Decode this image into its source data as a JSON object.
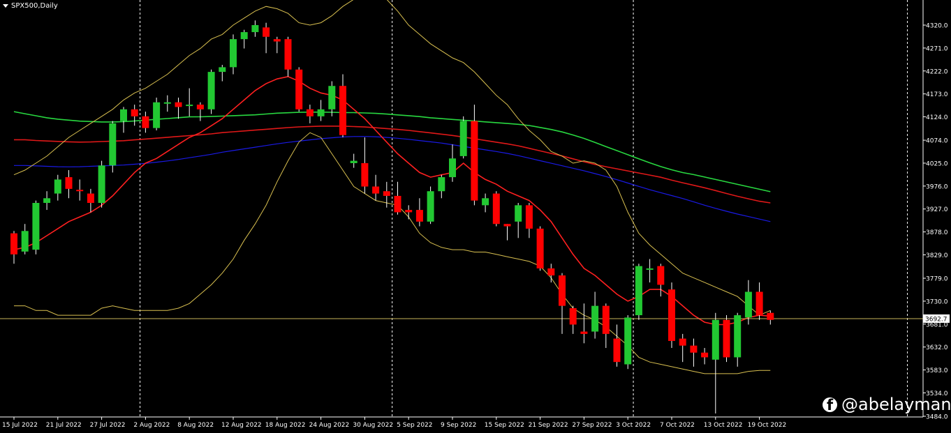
{
  "symbol_label": "SPX500,Daily",
  "watermark": {
    "icon": "facebook-icon",
    "handle": "@abelayman"
  },
  "colors": {
    "background": "#000000",
    "axis": "#ffffff",
    "text": "#ffffff",
    "bull": "#22c832",
    "bear": "#ff0000",
    "wick": "#ffffff",
    "bollinger": "#d9c050",
    "ema_fast": "#ff2020",
    "ma_green": "#28d840",
    "ma_red": "#e01818",
    "ma_blue": "#1a1ae6",
    "price_line": "#c8b45a"
  },
  "chart_data": {
    "type": "candlestick",
    "title": "SPX500,Daily",
    "ylim": [
      3484.0,
      4340.0
    ],
    "y_ticks": [
      "4320.0",
      "4271.0",
      "4222.0",
      "4173.0",
      "4124.0",
      "4074.0",
      "4025.0",
      "3976.0",
      "3927.0",
      "3878.0",
      "3829.0",
      "3779.0",
      "3730.0",
      "3681.0",
      "3632.0",
      "3583.0",
      "3534.0",
      "3484.0"
    ],
    "x_ticks": [
      {
        "i": 0,
        "label": "15 Jul 2022"
      },
      {
        "i": 4,
        "label": "21 Jul 2022"
      },
      {
        "i": 8,
        "label": "27 Jul 2022"
      },
      {
        "i": 12,
        "label": "2 Aug 2022"
      },
      {
        "i": 16,
        "label": "8 Aug 2022"
      },
      {
        "i": 20,
        "label": "12 Aug 2022"
      },
      {
        "i": 24,
        "label": "18 Aug 2022"
      },
      {
        "i": 28,
        "label": "24 Aug 2022"
      },
      {
        "i": 32,
        "label": "30 Aug 2022"
      },
      {
        "i": 36,
        "label": "5 Sep 2022"
      },
      {
        "i": 40,
        "label": "9 Sep 2022"
      },
      {
        "i": 44,
        "label": "15 Sep 2022"
      },
      {
        "i": 48,
        "label": "21 Sep 2022"
      },
      {
        "i": 52,
        "label": "27 Sep 2022"
      },
      {
        "i": 56,
        "label": "3 Oct 2022"
      },
      {
        "i": 60,
        "label": "7 Oct 2022"
      },
      {
        "i": 64,
        "label": "13 Oct 2022"
      },
      {
        "i": 68,
        "label": "19 Oct 2022"
      }
    ],
    "period_separators": [
      11,
      34,
      56,
      81
    ],
    "current_price": "3692.7",
    "candles": [
      [
        3875,
        3830,
        3810,
        3880
      ],
      [
        3836,
        3880,
        3830,
        3895
      ],
      [
        3840,
        3940,
        3830,
        3945
      ],
      [
        3940,
        3950,
        3925,
        3965
      ],
      [
        3960,
        3990,
        3945,
        4000
      ],
      [
        3995,
        3970,
        3950,
        4010
      ],
      [
        3968,
        3965,
        3945,
        3990
      ],
      [
        3960,
        3940,
        3920,
        3970
      ],
      [
        3940,
        4020,
        3930,
        4030
      ],
      [
        4020,
        4110,
        4005,
        4115
      ],
      [
        4115,
        4140,
        4090,
        4145
      ],
      [
        4140,
        4125,
        4105,
        4150
      ],
      [
        4125,
        4100,
        4090,
        4135
      ],
      [
        4100,
        4155,
        4095,
        4165
      ],
      [
        4155,
        4155,
        4135,
        4170
      ],
      [
        4155,
        4145,
        4120,
        4165
      ],
      [
        4150,
        4150,
        4125,
        4185
      ],
      [
        4150,
        4140,
        4115,
        4155
      ],
      [
        4140,
        4220,
        4130,
        4225
      ],
      [
        4220,
        4230,
        4200,
        4235
      ],
      [
        4230,
        4290,
        4215,
        4300
      ],
      [
        4290,
        4305,
        4270,
        4310
      ],
      [
        4305,
        4320,
        4295,
        4330
      ],
      [
        4315,
        4295,
        4260,
        4325
      ],
      [
        4290,
        4285,
        4260,
        4295
      ],
      [
        4290,
        4225,
        4210,
        4295
      ],
      [
        4225,
        4140,
        4135,
        4230
      ],
      [
        4140,
        4125,
        4110,
        4150
      ],
      [
        4125,
        4140,
        4115,
        4160
      ],
      [
        4140,
        4190,
        4125,
        4200
      ],
      [
        4190,
        4085,
        4080,
        4215
      ],
      [
        4025,
        4030,
        4015,
        4045
      ],
      [
        4025,
        3975,
        3960,
        4080
      ],
      [
        3975,
        3960,
        3945,
        4000
      ],
      [
        3965,
        3955,
        3930,
        3985
      ],
      [
        3955,
        3920,
        3915,
        3985
      ],
      [
        3925,
        3920,
        3905,
        3935
      ],
      [
        3925,
        3900,
        3890,
        3950
      ],
      [
        3900,
        3965,
        3895,
        3975
      ],
      [
        3965,
        3995,
        3950,
        4000
      ],
      [
        3995,
        4035,
        3985,
        4065
      ],
      [
        4040,
        4115,
        4035,
        4125
      ],
      [
        4115,
        3945,
        3935,
        4150
      ],
      [
        3935,
        3950,
        3920,
        3960
      ],
      [
        3960,
        3895,
        3890,
        3965
      ],
      [
        3895,
        3890,
        3860,
        3895
      ],
      [
        3900,
        3935,
        3865,
        3940
      ],
      [
        3935,
        3885,
        3865,
        3940
      ],
      [
        3885,
        3800,
        3795,
        3890
      ],
      [
        3800,
        3785,
        3770,
        3810
      ],
      [
        3785,
        3720,
        3660,
        3790
      ],
      [
        3715,
        3680,
        3660,
        3720
      ],
      [
        3665,
        3660,
        3640,
        3725
      ],
      [
        3665,
        3720,
        3650,
        3750
      ],
      [
        3720,
        3660,
        3630,
        3725
      ],
      [
        3650,
        3600,
        3590,
        3680
      ],
      [
        3595,
        3695,
        3585,
        3700
      ],
      [
        3700,
        3805,
        3690,
        3810
      ],
      [
        3800,
        3800,
        3770,
        3820
      ],
      [
        3805,
        3765,
        3740,
        3810
      ],
      [
        3755,
        3645,
        3630,
        3770
      ],
      [
        3650,
        3635,
        3600,
        3660
      ],
      [
        3635,
        3620,
        3590,
        3650
      ],
      [
        3620,
        3610,
        3595,
        3630
      ],
      [
        3605,
        3690,
        3490,
        3705
      ],
      [
        3690,
        3610,
        3600,
        3700
      ],
      [
        3610,
        3700,
        3590,
        3705
      ],
      [
        3695,
        3750,
        3680,
        3775
      ],
      [
        3750,
        3700,
        3690,
        3770
      ],
      [
        3705,
        3690,
        3680,
        3710
      ]
    ],
    "indicators": {
      "ema_fast_red": [
        3840,
        3845,
        3855,
        3870,
        3885,
        3900,
        3910,
        3920,
        3935,
        3955,
        3980,
        4005,
        4025,
        4035,
        4050,
        4065,
        4080,
        4090,
        4105,
        4120,
        4140,
        4160,
        4180,
        4195,
        4205,
        4210,
        4200,
        4185,
        4175,
        4170,
        4160,
        4140,
        4120,
        4095,
        4070,
        4045,
        4025,
        4005,
        3995,
        4000,
        4005,
        4025,
        4005,
        3990,
        3980,
        3965,
        3955,
        3945,
        3925,
        3900,
        3865,
        3830,
        3800,
        3785,
        3765,
        3745,
        3730,
        3740,
        3755,
        3755,
        3740,
        3720,
        3700,
        3685,
        3680,
        3680,
        3685,
        3695,
        3700,
        3698
      ],
      "bb_upper": [
        4000,
        4010,
        4025,
        4040,
        4060,
        4080,
        4095,
        4110,
        4125,
        4140,
        4160,
        4175,
        4185,
        4200,
        4215,
        4235,
        4255,
        4270,
        4290,
        4300,
        4320,
        4335,
        4350,
        4360,
        4355,
        4345,
        4325,
        4320,
        4325,
        4340,
        4360,
        4375,
        4385,
        4380,
        4375,
        4350,
        4320,
        4300,
        4280,
        4265,
        4250,
        4240,
        4220,
        4195,
        4170,
        4150,
        4120,
        4095,
        4075,
        4050,
        4040,
        4025,
        4030,
        4025,
        4010,
        3975,
        3920,
        3875,
        3850,
        3830,
        3810,
        3790,
        3780,
        3770,
        3760,
        3750,
        3740,
        3720,
        3700,
        3710
      ],
      "bb_lower": [
        3720,
        3720,
        3710,
        3710,
        3700,
        3700,
        3700,
        3700,
        3715,
        3720,
        3715,
        3710,
        3710,
        3710,
        3710,
        3715,
        3725,
        3745,
        3765,
        3790,
        3820,
        3860,
        3895,
        3935,
        3985,
        4030,
        4070,
        4090,
        4080,
        4045,
        4010,
        3975,
        3960,
        3945,
        3940,
        3935,
        3910,
        3875,
        3855,
        3845,
        3840,
        3840,
        3835,
        3835,
        3830,
        3825,
        3820,
        3815,
        3805,
        3780,
        3745,
        3715,
        3700,
        3690,
        3675,
        3655,
        3635,
        3610,
        3600,
        3595,
        3590,
        3585,
        3580,
        3575,
        3575,
        3575,
        3575,
        3580,
        3582,
        3582
      ],
      "ma_green": [
        4135,
        4130,
        4125,
        4120,
        4118,
        4115,
        4114,
        4113,
        4113,
        4114,
        4116,
        4118,
        4120,
        4122,
        4124,
        4124,
        4125,
        4126,
        4127,
        4128,
        4130,
        4132,
        4133,
        4134,
        4134,
        4134,
        4133,
        4133,
        4132,
        4131,
        4129,
        4127,
        4125,
        4122,
        4120,
        4118,
        4116,
        4114,
        4112,
        4110,
        4108,
        4105,
        4100,
        4095,
        4088,
        4080,
        4070,
        4060,
        4050,
        4040,
        4030,
        4020,
        4012,
        4005,
        4000,
        3994,
        3988,
        3982,
        3976,
        3970,
        3964
      ],
      "ma_red": [
        4075,
        4075,
        4073,
        4072,
        4071,
        4070,
        4070,
        4071,
        4072,
        4073,
        4075,
        4077,
        4079,
        4081,
        4083,
        4085,
        4087,
        4090,
        4092,
        4094,
        4096,
        4098,
        4100,
        4102,
        4103,
        4104,
        4104,
        4104,
        4103,
        4102,
        4100,
        4098,
        4096,
        4093,
        4090,
        4087,
        4084,
        4080,
        4076,
        4072,
        4068,
        4064,
        4058,
        4052,
        4046,
        4040,
        4033,
        4026,
        4020,
        4015,
        4010,
        4005,
        4000,
        3995,
        3988,
        3982,
        3976,
        3970,
        3963,
        3956,
        3950,
        3944,
        3940
      ],
      "ma_blue": [
        4020,
        4020,
        4019,
        4018,
        4017,
        4017,
        4018,
        4019,
        4020,
        4021,
        4023,
        4025,
        4028,
        4031,
        4035,
        4039,
        4043,
        4048,
        4052,
        4056,
        4060,
        4064,
        4068,
        4071,
        4074,
        4077,
        4079,
        4081,
        4082,
        4082,
        4081,
        4079,
        4077,
        4074,
        4071,
        4068,
        4064,
        4060,
        4056,
        4052,
        4048,
        4043,
        4037,
        4031,
        4025,
        4019,
        4013,
        4007,
        4000,
        3993,
        3985,
        3977,
        3969,
        3962,
        3955,
        3948,
        3940,
        3932,
        3925,
        3918,
        3912,
        3906,
        3900
      ]
    }
  }
}
